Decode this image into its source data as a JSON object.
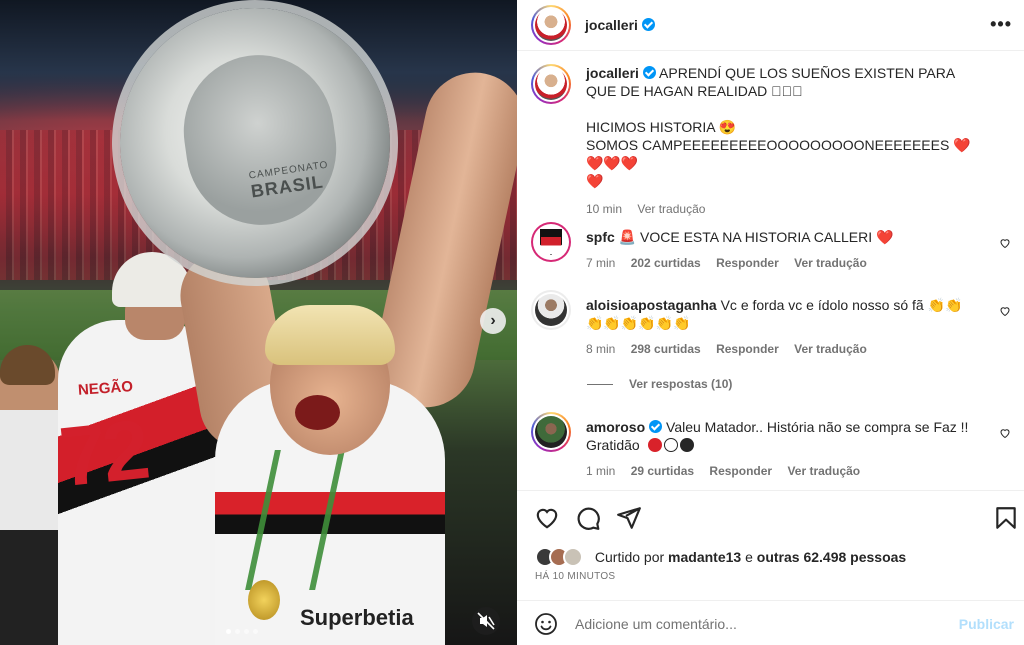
{
  "header": {
    "username": "jocalleri",
    "more_icon": "more-horizontal-icon"
  },
  "caption": {
    "username": "jocalleri",
    "line1": "APRENDÍ QUE LOS SUEÑOS EXISTEN PARA QUE DE HAGAN REALIDAD ",
    "line1_emoji": "🏾🏾🏾",
    "line2": "HICIMOS HISTORIA 😍",
    "line3": "SOMOS CAMPEEEEEEEEEOOOOOOOOONEEEEEEES ❤️❤️❤️❤️",
    "line4": "❤️",
    "time": "10 min",
    "translate": "Ver tradução"
  },
  "comments": [
    {
      "username": "spfc",
      "text": "🚨 VOCE ESTA NA HISTORIA CALLERI ❤️",
      "time": "7 min",
      "likes": "202 curtidas",
      "reply": "Responder",
      "translate": "Ver tradução"
    },
    {
      "username": "aloisioapostaganha",
      "text": "Vc e forda vc e ídolo nosso só fã 👏👏",
      "text2": "👏👏👏👏👏👏",
      "time": "8 min",
      "likes": "298 curtidas",
      "reply": "Responder",
      "translate": "Ver tradução",
      "view_replies": "Ver respostas (10)"
    },
    {
      "username": "amoroso",
      "text": "Valeu Matador.. História não se compra se Faz !!",
      "text2": "Gratidão",
      "time": "1 min",
      "likes": "29 curtidas",
      "reply": "Responder",
      "translate": "Ver tradução",
      "circle_colors": [
        "#d9222a",
        "#ffffff",
        "#262626"
      ]
    }
  ],
  "likes": {
    "prefix": "Curtido por",
    "user": "madante13",
    "middle": "e",
    "others": "outras 62.498 pessoas"
  },
  "timestamp": "HÁ 10 MINUTOS",
  "composer": {
    "placeholder": "Adicione um comentário...",
    "publish": "Publicar"
  },
  "media": {
    "trophy_text_top": "CAMPEONATO",
    "trophy_text_bottom": "BRASIL",
    "shirt_name": "NEGÃO",
    "shirt_number": "72",
    "sponsor": "Superbetia",
    "next_icon": "chevron-right-icon",
    "mute_icon": "speaker-muted-icon"
  },
  "colors": {
    "accent": "#0095f6",
    "publish_disabled": "#b2dffc",
    "heart": "#e0163a",
    "text": "#262626",
    "secondary": "#737373"
  }
}
